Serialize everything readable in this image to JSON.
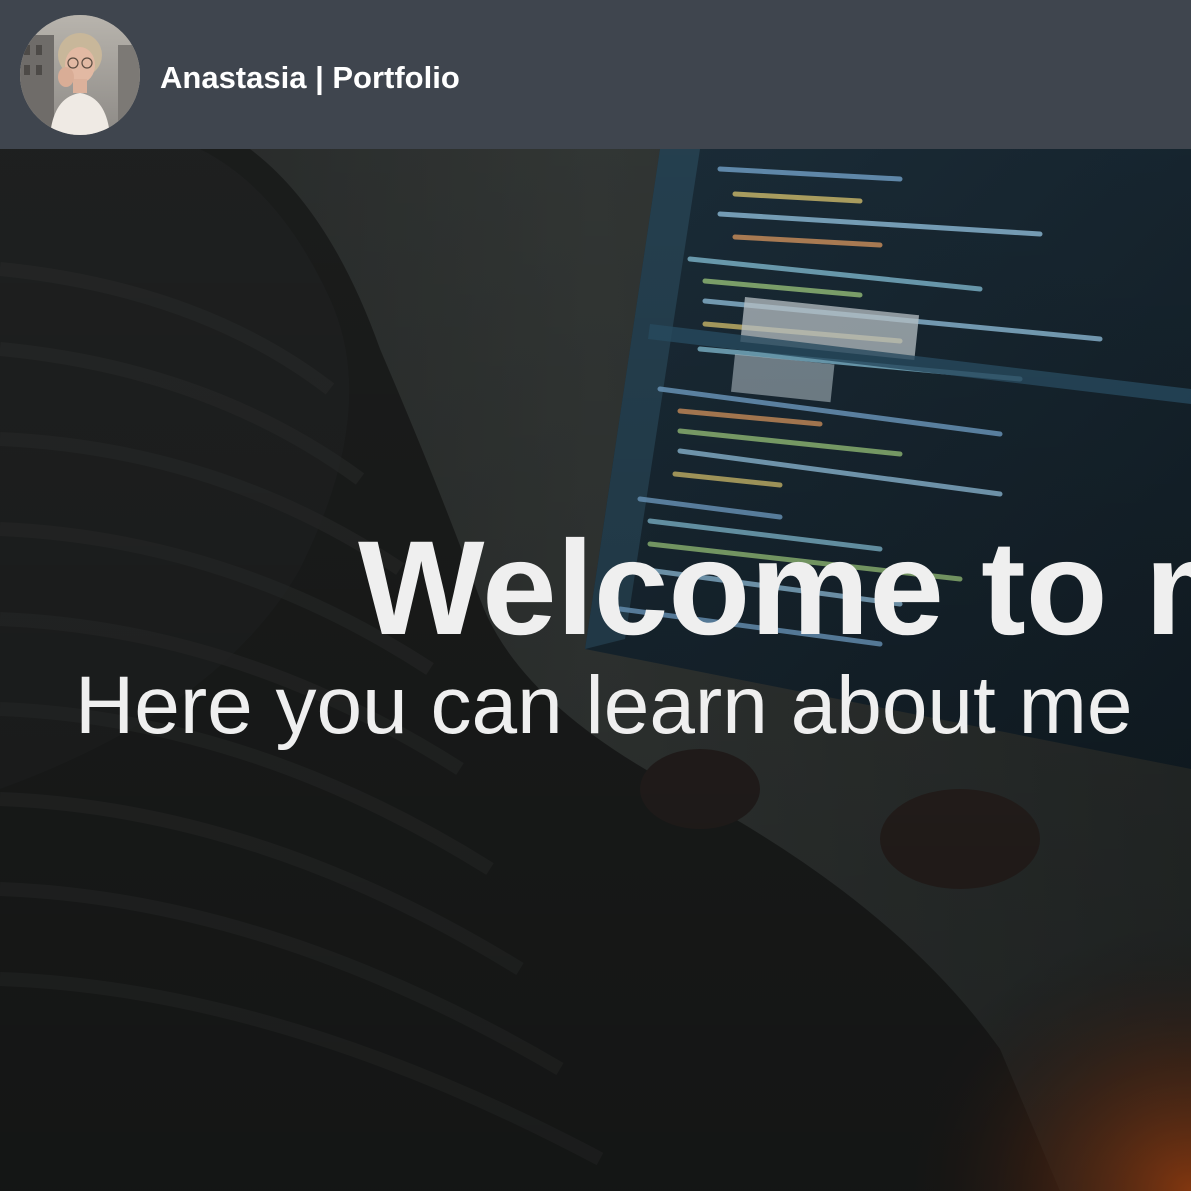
{
  "navbar": {
    "avatar_icon": "profile-photo",
    "brand": "Anastasia | Portfolio",
    "background_color": "#3f454e"
  },
  "hero": {
    "background_image": "code-editor-on-laptop-photo",
    "title": "Welcome to m",
    "subtitle": "Here you can learn about me",
    "text_color": "#efefef"
  }
}
